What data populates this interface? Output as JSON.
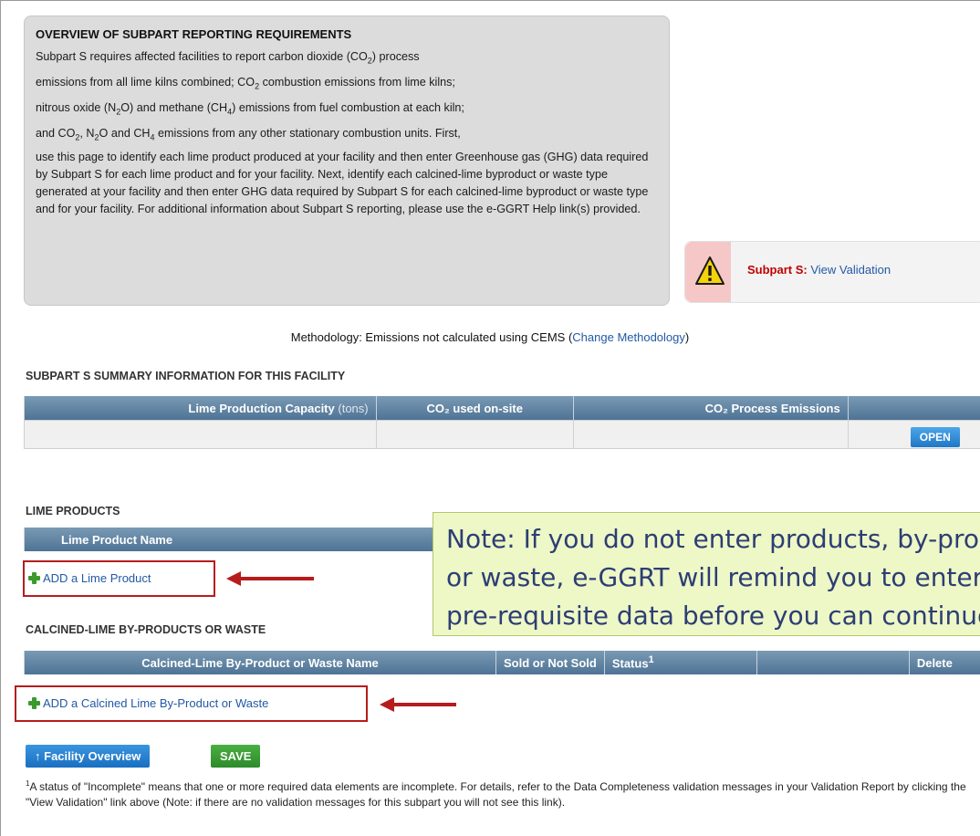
{
  "overview": {
    "title": "OVERVIEW OF SUBPART REPORTING REQUIREMENTS",
    "line1": "Subpart S requires affected facilities to report carbon dioxide (CO",
    "line1b": ") process",
    "line2a": "emissions from all lime kilns combined; CO",
    "line2b": " combustion emissions from lime kilns;",
    "line3a": "nitrous oxide (N",
    "line3b": "O) and methane (CH",
    "line3c": ") emissions from fuel combustion at each kiln;",
    "line4a": "and CO",
    "line4b": ", N",
    "line4c": "O and CH",
    "line4d": " emissions from any other stationary combustion units. First,",
    "rest": "use this page to identify each lime product produced at your facility and then enter Greenhouse gas (GHG) data required by Subpart S for each lime product and for your facility. Next, identify each calcined-lime byproduct or waste type generated at your facility and then enter GHG data required by Subpart S for each calcined-lime byproduct or waste type and for your facility. For additional information about Subpart S reporting, please use the e-GGRT Help link(s) provided.",
    "sub2": "2",
    "sub4": "4"
  },
  "validation": {
    "subpart_label": "Subpart S:",
    "link": "View Validation"
  },
  "methodology": {
    "prefix": "Methodology: Emissions not calculated using CEMS (",
    "link": "Change Methodology",
    "suffix": ")"
  },
  "summary": {
    "title": "SUBPART S SUMMARY INFORMATION FOR THIS FACILITY",
    "col1": "Lime Production Capacity",
    "col1_unit": "(tons)",
    "col2": "CO₂ used on-site",
    "col3": "CO₂ Process Emissions",
    "open_button": "OPEN"
  },
  "lime_products": {
    "title": "LIME PRODUCTS",
    "col1": "Lime Product Name",
    "add_link": "ADD a Lime Product"
  },
  "calcined": {
    "title": "CALCINED-LIME BY-PRODUCTS OR WASTE",
    "col1": "Calcined-Lime By-Product or Waste Name",
    "col2": "Sold or Not Sold",
    "col3": "Status",
    "col3_sup": "1",
    "col5": "Delete",
    "add_link": "ADD a Calcined Lime By-Product or Waste"
  },
  "note": {
    "line1": "Note: If you do not enter products, by-products,",
    "line2": "or waste, e-GGRT will remind you to enter the",
    "line3": "pre-requisite data before you can continue."
  },
  "buttons": {
    "facility_overview": "Facility Overview",
    "save": "SAVE"
  },
  "footnote": {
    "marker": "1",
    "text": "A status of \"Incomplete\" means that one or more required data elements are incomplete. For details, refer to the Data Completeness validation messages in your Validation Report by clicking the \"View Validation\" link above (Note: if there are no validation messages for this subpart you will not see this link)."
  },
  "colors": {
    "accent_red": "#b71c1c",
    "link_blue": "#2259a5",
    "header_blue": "#5b7f9f"
  }
}
